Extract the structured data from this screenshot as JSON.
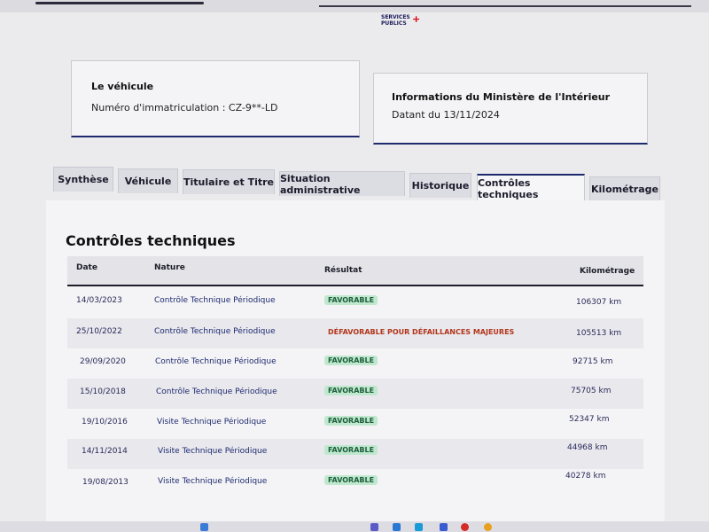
{
  "logo": {
    "line1": "SERVICES",
    "line2": "PUBLICS",
    "plus": "+"
  },
  "vehicle_card": {
    "title": "Le véhicule",
    "plate_label": "Numéro d'immatriculation : CZ-9**-LD"
  },
  "ministry_card": {
    "title": "Informations du Ministère de l'Intérieur",
    "date_label": "Datant du 13/11/2024"
  },
  "tabs": [
    {
      "label": "Synthèse"
    },
    {
      "label": "Véhicule"
    },
    {
      "label": "Titulaire et Titre"
    },
    {
      "label": "Situation administrative"
    },
    {
      "label": "Historique"
    },
    {
      "label": "Contrôles techniques",
      "active": true
    },
    {
      "label": "Kilométrage"
    }
  ],
  "section": {
    "title": "Contrôles techniques"
  },
  "table": {
    "headers": {
      "date": "Date",
      "nature": "Nature",
      "result": "Résultat",
      "km": "Kilométrage"
    },
    "rows": [
      {
        "date": "14/03/2023",
        "nature": "Contrôle Technique Périodique",
        "result": "FAVORABLE",
        "status": "favorable",
        "km": "106307 km"
      },
      {
        "date": "25/10/2022",
        "nature": "Contrôle Technique Périodique",
        "result": "DÉFAVORABLE POUR DÉFAILLANCES MAJEURES",
        "status": "defavorable",
        "km": "105513 km"
      },
      {
        "date": "29/09/2020",
        "nature": "Contrôle Technique Périodique",
        "result": "FAVORABLE",
        "status": "favorable",
        "km": "92715 km"
      },
      {
        "date": "15/10/2018",
        "nature": "Contrôle Technique Périodique",
        "result": "FAVORABLE",
        "status": "favorable",
        "km": "75705 km"
      },
      {
        "date": "19/10/2016",
        "nature": "Visite Technique Périodique",
        "result": "FAVORABLE",
        "status": "favorable",
        "km": "52347 km"
      },
      {
        "date": "14/11/2014",
        "nature": "Visite Technique Périodique",
        "result": "FAVORABLE",
        "status": "favorable",
        "km": "44968 km"
      },
      {
        "date": "19/08/2013",
        "nature": "Visite Technique Périodique",
        "result": "FAVORABLE",
        "status": "favorable",
        "km": "40278 km"
      }
    ]
  },
  "colors": {
    "accent": "#1e2a6e",
    "favorable_bg": "#bfe8cf",
    "favorable_fg": "#1d5e3a",
    "defavorable": "#b3351a"
  }
}
